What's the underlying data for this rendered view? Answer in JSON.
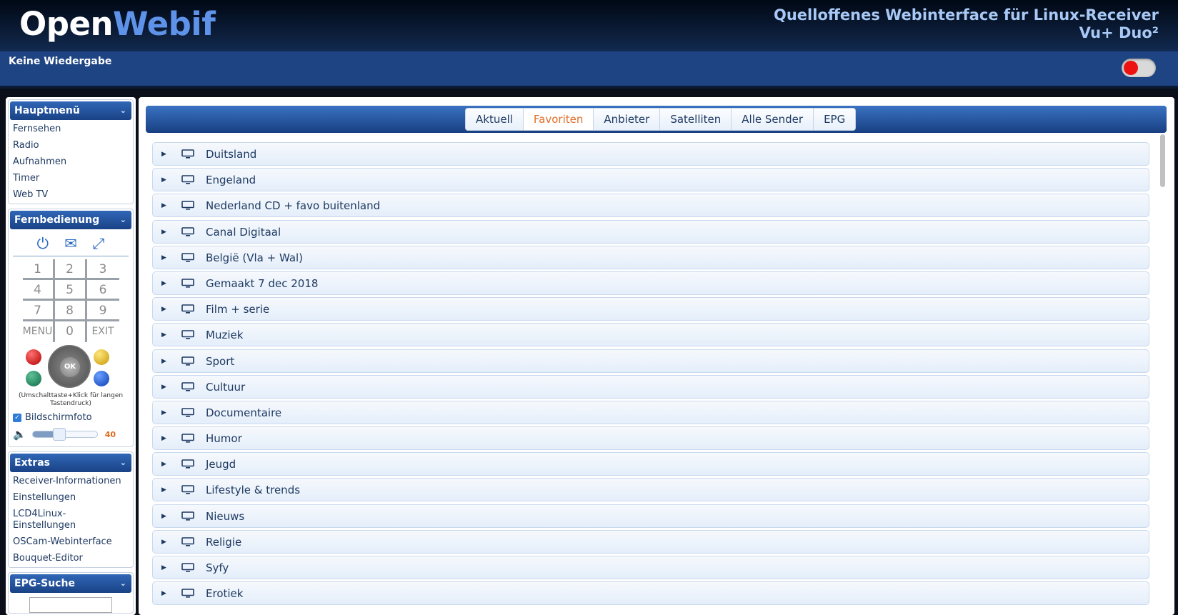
{
  "header": {
    "logo_open": "Open",
    "logo_webif": "Webif",
    "tagline": "Quelloffenes Webinterface für Linux-Receiver",
    "model": "Vu+ Duo²"
  },
  "status": {
    "now_playing": "Keine Wiedergabe"
  },
  "sidebar": {
    "main_menu": {
      "title": "Hauptmenü",
      "items": [
        "Fernsehen",
        "Radio",
        "Aufnahmen",
        "Timer",
        "Web TV"
      ]
    },
    "remote": {
      "title": "Fernbedienung",
      "keys": [
        "1",
        "2",
        "3",
        "4",
        "5",
        "6",
        "7",
        "8",
        "9",
        "MENU",
        "0",
        "EXIT"
      ],
      "ok_label": "OK",
      "hint": "(Umschalttaste+Klick für langen Tastendruck)",
      "screenshot_label": "Bildschirmfoto",
      "screenshot_checked": true,
      "volume": "40"
    },
    "extras": {
      "title": "Extras",
      "items": [
        "Receiver-Informationen",
        "Einstellungen",
        "LCD4Linux-Einstellungen",
        "OSCam-Webinterface",
        "Bouquet-Editor"
      ]
    },
    "epg_search": {
      "title": "EPG-Suche",
      "value": ""
    }
  },
  "main": {
    "tabs": [
      "Aktuell",
      "Favoriten",
      "Anbieter",
      "Satelliten",
      "Alle Sender",
      "EPG"
    ],
    "active_tab": "Favoriten",
    "bouquets": [
      "Duitsland",
      "Engeland",
      "Nederland CD + favo buitenland",
      "Canal Digitaal",
      "België (Vla + Wal)",
      "Gemaakt 7 dec 2018",
      "Film + serie",
      "Muziek",
      "Sport",
      "Cultuur",
      "Documentaire",
      "Humor",
      "Jeugd",
      "Lifestyle & trends",
      "Nieuws",
      "Religie",
      "Syfy",
      "Erotiek"
    ]
  },
  "colors": {
    "accent": "#1e4483",
    "active_tab": "#e0702a",
    "toggle_knob": "#ee1111"
  }
}
